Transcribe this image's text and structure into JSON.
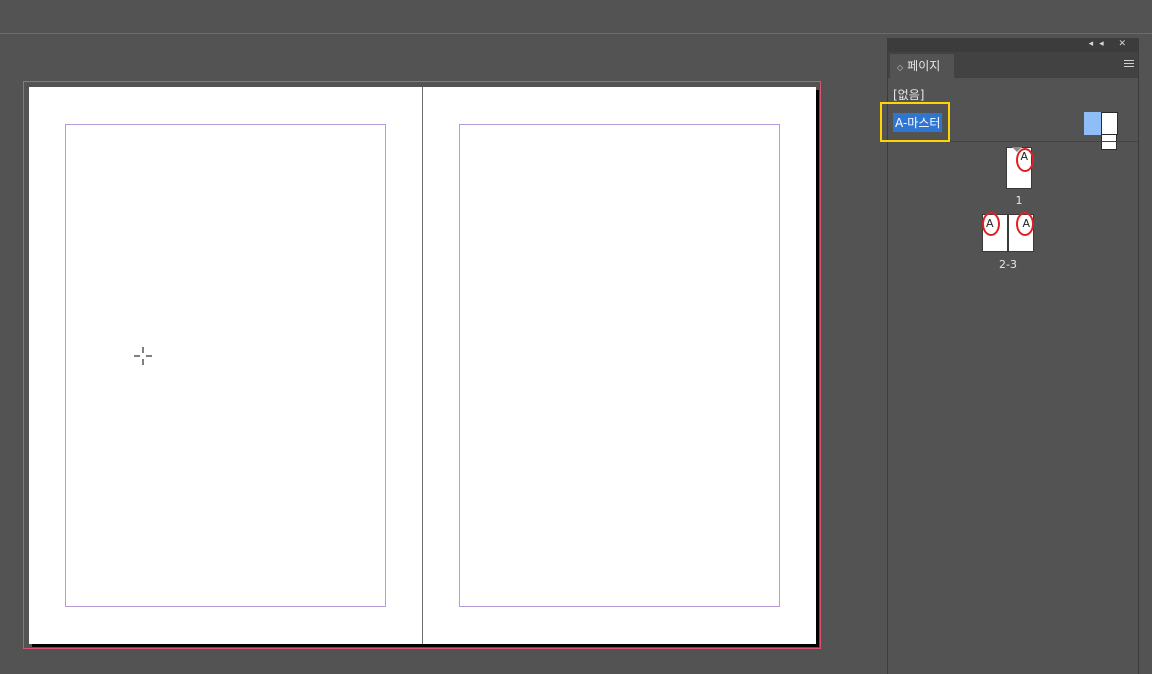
{
  "panel": {
    "tab_label": "페이지",
    "tab_arrow": "◇",
    "dock_icons": "◂◂ ✕",
    "masters": [
      {
        "label": "[없음]"
      },
      {
        "label": "A-마스터"
      }
    ],
    "pages": [
      {
        "label": "1",
        "master_prefix": "A"
      },
      {
        "label": "2-3",
        "master_prefix_left": "A",
        "master_prefix_right": "A"
      }
    ]
  },
  "colors": {
    "bleed_guide": "#d9536f",
    "margin_guide": "#b79ad8",
    "selection_highlight": "#2f76d2",
    "annotation_yellow": "#ffd400",
    "annotation_red": "#e02020"
  }
}
